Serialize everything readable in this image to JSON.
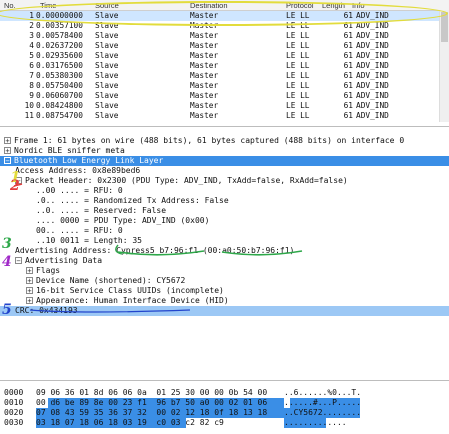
{
  "packet_list": {
    "headers": {
      "no": "No.",
      "time": "Time",
      "source": "Source",
      "destination": "Destination",
      "protocol": "Protocol",
      "length": "Length",
      "info": "Info"
    },
    "rows": [
      {
        "no": "1",
        "time": "0.00000000",
        "src": "Slave",
        "dst": "Master",
        "proto": "LE LL",
        "len": "61",
        "info": "ADV_IND"
      },
      {
        "no": "2",
        "time": "0.00357100",
        "src": "Slave",
        "dst": "Master",
        "proto": "LE LL",
        "len": "61",
        "info": "ADV_IND"
      },
      {
        "no": "3",
        "time": "0.00578400",
        "src": "Slave",
        "dst": "Master",
        "proto": "LE LL",
        "len": "61",
        "info": "ADV_IND"
      },
      {
        "no": "4",
        "time": "0.02637200",
        "src": "Slave",
        "dst": "Master",
        "proto": "LE LL",
        "len": "61",
        "info": "ADV_IND"
      },
      {
        "no": "5",
        "time": "0.02935600",
        "src": "Slave",
        "dst": "Master",
        "proto": "LE LL",
        "len": "61",
        "info": "ADV_IND"
      },
      {
        "no": "6",
        "time": "0.03176500",
        "src": "Slave",
        "dst": "Master",
        "proto": "LE LL",
        "len": "61",
        "info": "ADV_IND"
      },
      {
        "no": "7",
        "time": "0.05380300",
        "src": "Slave",
        "dst": "Master",
        "proto": "LE LL",
        "len": "61",
        "info": "ADV_IND"
      },
      {
        "no": "8",
        "time": "0.05750400",
        "src": "Slave",
        "dst": "Master",
        "proto": "LE LL",
        "len": "61",
        "info": "ADV_IND"
      },
      {
        "no": "9",
        "time": "0.06060700",
        "src": "Slave",
        "dst": "Master",
        "proto": "LE LL",
        "len": "61",
        "info": "ADV_IND"
      },
      {
        "no": "10",
        "time": "0.08424800",
        "src": "Slave",
        "dst": "Master",
        "proto": "LE LL",
        "len": "61",
        "info": "ADV_IND"
      },
      {
        "no": "11",
        "time": "0.08754700",
        "src": "Slave",
        "dst": "Master",
        "proto": "LE LL",
        "len": "61",
        "info": "ADV_IND"
      }
    ]
  },
  "details": {
    "frame": "Frame 1: 61 bytes on wire (488 bits), 61 bytes captured (488 bits) on interface 0",
    "sniffer": "Nordic BLE sniffer meta",
    "ble": "Bluetooth Low Energy Link Layer",
    "access_address": "Access Address: 0x8e89bed6",
    "packet_header": "Packet Header: 0x2300 (PDU Type: ADV_IND, TxAdd=false, RxAdd=false)",
    "rfu1": "..00 .... = RFU: 0",
    "randomized": ".0.. .... = Randomized Tx Address: False",
    "reserved": "..0. .... = Reserved: False",
    "pdu_type": ".... 0000 = PDU Type: ADV_IND (0x00)",
    "rfu2": "00.. .... = RFU: 0",
    "length": "..10 0011 = Length: 35",
    "adv_address": "Advertising Address: Cypress5_b7:96:f1 (00:a0:50:b7:96:f1)",
    "adv_data": "Advertising Data",
    "flags": "Flags",
    "device_name": "Device Name (shortened): CY5672",
    "uuids": "16-bit Service Class UUIDs (incomplete)",
    "appearance": "Appearance: Human Interface Device (HID)",
    "crc": "CRC: 0x434193"
  },
  "annotations": [
    "1",
    "2",
    "3",
    "4",
    "5"
  ],
  "hex": {
    "rows": [
      {
        "off": "0000",
        "bytes": "09 06 36 01 8d 06 06 0a  01 25 30 00 00 0b 54 00",
        "ascii": "..6......%0...T."
      },
      {
        "off": "0010",
        "bytes": "00 d6 be 89 8e 00 23 f1  96 b7 50 a0 00 02 01 06",
        "ascii": "......#...P....."
      },
      {
        "off": "0020",
        "bytes": "07 08 43 59 35 36 37 32  00 02 12 18 0f 18 13 18",
        "ascii": "..CY5672........"
      },
      {
        "off": "0030",
        "bytes": "03 18 07 18 06 18 03 19  c0 03 c2 82 c9",
        "ascii": "............."
      }
    ]
  },
  "colors": {
    "selection": "#3a8ee6",
    "row_highlight": "#cfe6ff",
    "ellipse": "#e2dc3c"
  }
}
